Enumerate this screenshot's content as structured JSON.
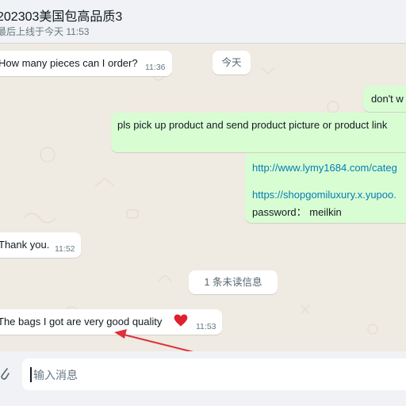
{
  "header": {
    "title": "202303美国包高品质3",
    "status": "最后上线于今天 11:53"
  },
  "messages": [
    {
      "text": "How many pieces can I order?",
      "time": "11:36"
    },
    {
      "date_label": "今天"
    },
    {
      "text": "don't w"
    },
    {
      "text": "pls pick up product and send product picture or product link"
    },
    {
      "link1": "http://www.lymy1684.com/categ",
      "link2": "https://shopgomiluxury.x.yupoo.",
      "password_text": "password： meilkin"
    },
    {
      "text": "Thank you.",
      "time": "11:52"
    },
    {
      "unread": "1 条未读信息"
    },
    {
      "text": "The bags I got are very good quality",
      "emoji": "❤️",
      "time": "11:53"
    }
  ],
  "composer": {
    "placeholder": "输入消息"
  },
  "colors": {
    "incoming_bubble": "#ffffff",
    "outgoing_bubble": "#d9fdd3",
    "chat_background": "#efeae2",
    "arrow": "#e0303b",
    "link": "#027eb5"
  },
  "icons": {
    "composer_left": "paperclip-icon",
    "heart": "heart-emoji"
  }
}
